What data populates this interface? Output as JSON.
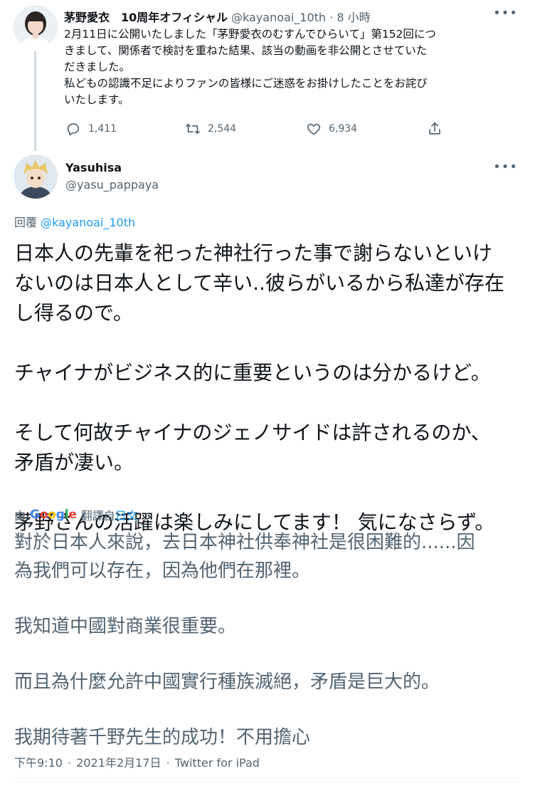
{
  "parent_tweet": {
    "author_name": "茅野愛衣　10周年オフィシャル",
    "handle": "@kayanoai_10th",
    "separator": "·",
    "time": "8 小時",
    "more_icon": "more-horizontal-icon",
    "text_lines": [
      "2月11日に公開いたしました「茅野愛衣のむすんでひらいて」第152回につ",
      "きまして、関係者で検討を重ねた結果、該当の動画を非公開とさせていた",
      "だきました。",
      "私どもの認識不足によりファンの皆様にご迷惑をお掛けしたことをお詫び",
      "いたします。"
    ],
    "actions": {
      "reply_count": "1,411",
      "retweet_count": "2,544",
      "like_count": "6,934"
    }
  },
  "reply_tweet": {
    "author_name": "Yasuhisa",
    "handle": "@yasu_pappaya",
    "replying_label": "回覆",
    "replying_to": "@kayanoai_10th",
    "text_lines": [
      "日本人の先輩を祀った神社行った事で謝らないといけ",
      "ないのは日本人として辛い..彼らがいるから私達が存在",
      "し得るので。",
      "",
      "チャイナがビジネス的に重要というのは分かるけど。",
      "",
      "そして何故チャイナのジェノサイドは許されるのか、",
      "矛盾が凄い。",
      "",
      "茅野さんの活躍は楽しみにしてます！ 気になさらず。"
    ],
    "translation": {
      "by_label": "由",
      "provider": "Google",
      "from_label": "翻譯自",
      "language": "日文",
      "text_lines": [
        "對於日本人來說，去日本神社供奉神社是很困難的......因",
        "為我們可以存在，因為他們在那裡。",
        "",
        "我知道中國對商業很重要。",
        "",
        "而且為什麼允許中國實行種族滅絕，矛盾是巨大的。",
        "",
        "我期待著千野先生的成功！不用擔心"
      ]
    },
    "meta": {
      "time": "下午9:10",
      "separator": "·",
      "date": "2021年2月17日",
      "source": "Twitter for iPad"
    }
  },
  "colors": {
    "text": "#0f1419",
    "muted": "#536471",
    "link": "#1d9bf0",
    "google_blue": "#4285F4",
    "google_red": "#EA4335",
    "google_yellow": "#FBBC05",
    "google_green": "#34A853"
  }
}
